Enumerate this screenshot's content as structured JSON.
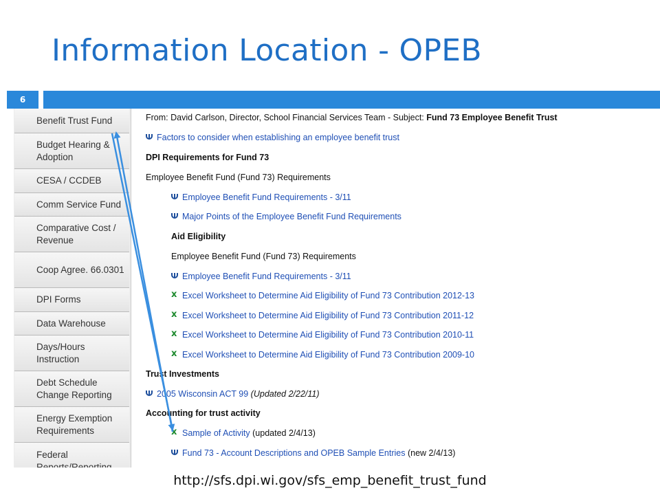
{
  "slide": {
    "title": "Information Location - OPEB",
    "number": "6",
    "url": "http://sfs.dpi.wi.gov/sfs_emp_benefit_trust_fund"
  },
  "sidebar": {
    "items": [
      {
        "label": "Benefit Trust Fund"
      },
      {
        "label": "Budget Hearing & Adoption"
      },
      {
        "label": "CESA / CCDEB"
      },
      {
        "label": "Comm Service Fund"
      },
      {
        "label": "Comparative Cost / Revenue"
      },
      {
        "label": "Coop Agree. 66.0301"
      },
      {
        "label": "DPI Forms"
      },
      {
        "label": "Data Warehouse"
      },
      {
        "label": "Days/Hours Instruction"
      },
      {
        "label": "Debt Schedule Change Reporting"
      },
      {
        "label": "Energy Exemption Requirements"
      },
      {
        "label": "Federal Reports/Reporting"
      }
    ]
  },
  "content": {
    "from_line": "From: David Carlson, Director, School Financial Services Team - Subject: ",
    "subject": "Fund 73 Employee Benefit Trust",
    "link_factors": "Factors to consider when establishing an employee benefit trust",
    "heading_dpi": "DPI Requirements for Fund 73",
    "text_req1": "Employee Benefit Fund (Fund 73) Requirements",
    "link_req_311": "Employee Benefit Fund Requirements - 3/11",
    "link_major": "Major Points of the Employee Benefit Fund Requirements",
    "heading_aid": "Aid Eligibility",
    "text_req2": "Employee Benefit Fund (Fund 73) Requirements",
    "link_req_311b": "Employee Benefit Fund Requirements - 3/11",
    "link_excel_1213": "Excel Worksheet to Determine Aid Eligibility of Fund 73 Contribution 2012-13",
    "link_excel_1112": "Excel Worksheet to Determine Aid Eligibility of Fund 73 Contribution 2011-12",
    "link_excel_1011": "Excel Worksheet to Determine Aid Eligibility of Fund 73 Contribution 2010-11",
    "link_excel_0910": "Excel Worksheet to Determine Aid Eligibility of Fund 73 Contribution 2009-10",
    "heading_trust": "Trust Investments",
    "link_act99": "2005 Wisconsin ACT 99",
    "act99_note": "(Updated 2/22/11)",
    "heading_accounting": "Accounting for trust activity",
    "link_sample": "Sample of Activity",
    "sample_note": "(updated 2/4/13)",
    "link_fund73": "Fund 73 - Account Descriptions and OPEB Sample Entries",
    "fund73_note": "(new 2/4/13)"
  },
  "colors": {
    "title": "#1f6fc5",
    "band": "#2a88da",
    "link": "#1f4fb5",
    "arrow": "#3a8fe0"
  }
}
